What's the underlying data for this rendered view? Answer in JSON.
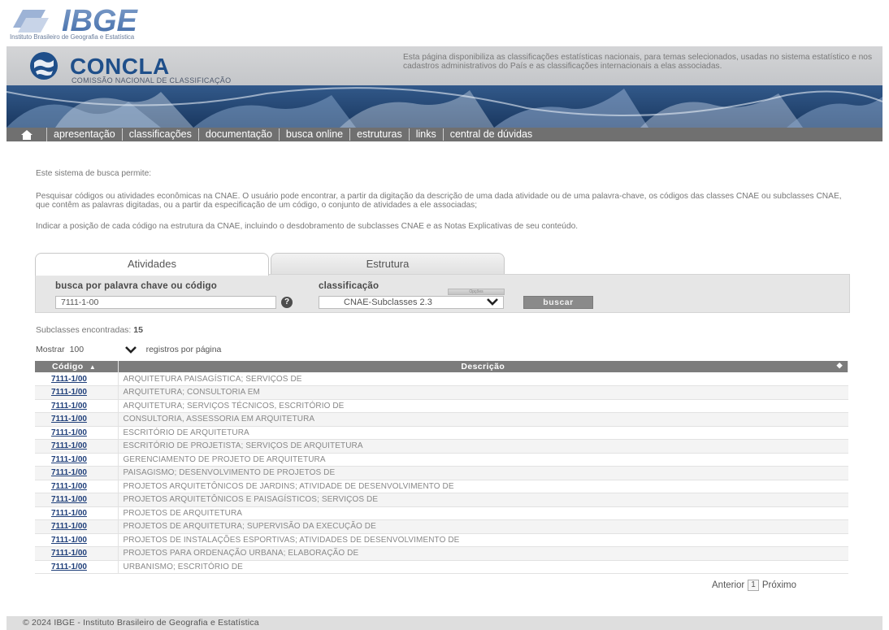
{
  "ibge": {
    "logo_text": "IBGE",
    "subtitle": "Instituto Brasileiro de Geografia e Estatística"
  },
  "concla": {
    "title": "CONCLA",
    "subtitle": "COMISSÃO NACIONAL DE CLASSIFICAÇÃO",
    "description": "Esta página disponibiliza as classificações estatísticas nacionais, para temas selecionados, usadas no sistema estatístico e nos cadastros administrativos do País e as classificações internacionais a elas associadas."
  },
  "nav": {
    "items": [
      "apresentação",
      "classificações",
      "documentação",
      "busca online",
      "estruturas",
      "links",
      "central de dúvidas"
    ]
  },
  "intro": {
    "line1": "Este sistema de busca permite:",
    "line2": "Pesquisar códigos ou atividades econômicas na CNAE. O usuário pode encontrar, a partir da digitação da descrição de uma dada atividade ou de uma palavra-chave, os códigos das classes CNAE ou subclasses CNAE, que contêm as palavras digitadas, ou a partir da especificação de um código, o conjunto de atividades a ele associadas;",
    "line3": "Indicar a posição de cada código na estrutura da CNAE, incluindo o desdobramento de subclasses CNAE e as Notas Explicativas de seu conteúdo."
  },
  "tabs": {
    "atividades": "Atividades",
    "estrutura": "Estrutura"
  },
  "search": {
    "label": "busca por palavra chave ou código",
    "value": "7111-1-00",
    "help": "?",
    "class_label": "classificação",
    "class_mini": "Opções",
    "class_value": "CNAE-Subclasses 2.3",
    "button": "buscar"
  },
  "results": {
    "count_label": "Subclasses encontradas:",
    "count": "15",
    "show_label": "Mostrar",
    "show_value": "100",
    "per_page": "registros por página",
    "col_code": "Código",
    "col_desc": "Descrição",
    "rows": [
      {
        "code": "7111-1/00",
        "desc": "ARQUITETURA PAISAGÍSTICA; SERVIÇOS DE"
      },
      {
        "code": "7111-1/00",
        "desc": "ARQUITETURA; CONSULTORIA EM"
      },
      {
        "code": "7111-1/00",
        "desc": "ARQUITETURA; SERVIÇOS TÉCNICOS, ESCRITÓRIO DE"
      },
      {
        "code": "7111-1/00",
        "desc": "CONSULTORIA, ASSESSORIA EM ARQUITETURA"
      },
      {
        "code": "7111-1/00",
        "desc": "ESCRITÓRIO DE ARQUITETURA"
      },
      {
        "code": "7111-1/00",
        "desc": "ESCRITÓRIO DE PROJETISTA; SERVIÇOS DE ARQUITETURA"
      },
      {
        "code": "7111-1/00",
        "desc": "GERENCIAMENTO DE PROJETO DE ARQUITETURA"
      },
      {
        "code": "7111-1/00",
        "desc": "PAISAGISMO; DESENVOLVIMENTO DE PROJETOS DE"
      },
      {
        "code": "7111-1/00",
        "desc": "PROJETOS ARQUITETÔNICOS DE JARDINS; ATIVIDADE DE DESENVOLVIMENTO DE"
      },
      {
        "code": "7111-1/00",
        "desc": "PROJETOS ARQUITETÔNICOS E PAISAGÍSTICOS; SERVIÇOS DE"
      },
      {
        "code": "7111-1/00",
        "desc": "PROJETOS DE ARQUITETURA"
      },
      {
        "code": "7111-1/00",
        "desc": "PROJETOS DE ARQUITETURA; SUPERVISÃO DA EXECUÇÃO DE"
      },
      {
        "code": "7111-1/00",
        "desc": "PROJETOS DE INSTALAÇÕES ESPORTIVAS; ATIVIDADES DE DESENVOLVIMENTO DE"
      },
      {
        "code": "7111-1/00",
        "desc": "PROJETOS PARA ORDENAÇÃO URBANA; ELABORAÇÃO DE"
      },
      {
        "code": "7111-1/00",
        "desc": "URBANISMO; ESCRITÓRIO DE"
      }
    ]
  },
  "pagination": {
    "prev": "Anterior",
    "current": "1",
    "next": "Próximo"
  },
  "footer": {
    "text": "© 2024 IBGE - Instituto Brasileiro de Geografia e Estatística"
  },
  "colors": {
    "brand_blue": "#1f4f8a",
    "nav_gray": "#707070",
    "link_blue": "#1f3f7a"
  }
}
